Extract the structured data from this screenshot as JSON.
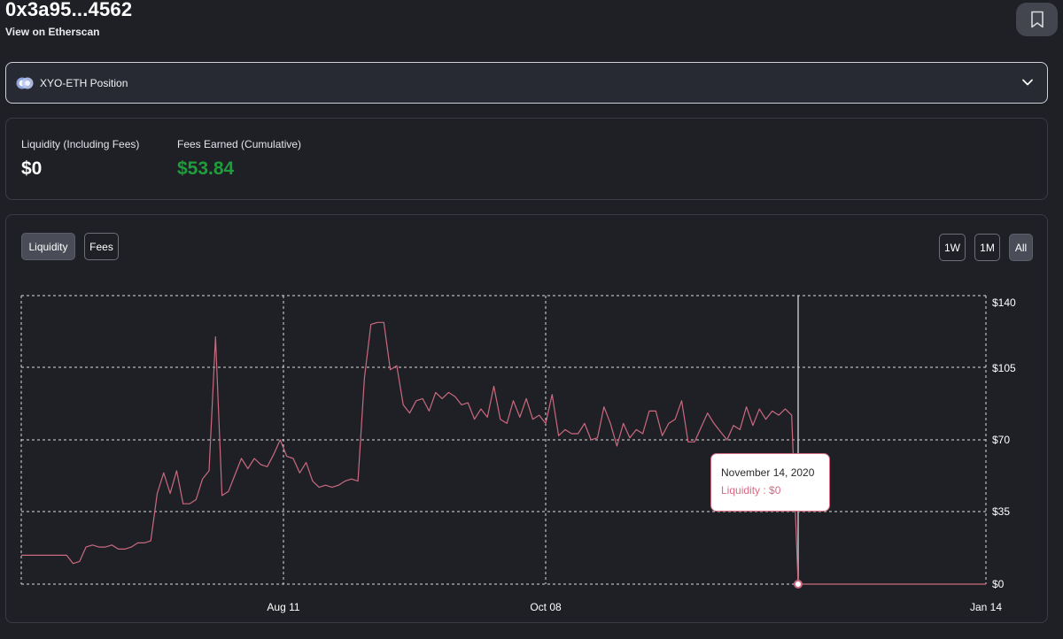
{
  "header": {
    "address": "0x3a95...4562",
    "etherscan_link": "View on Etherscan"
  },
  "icons": {
    "bookmark": "bookmark-icon",
    "token_pair": "token-pair-icon",
    "dropdown": "chevron-down-icon"
  },
  "position_select": {
    "selected": "XYO-ETH Position"
  },
  "stats": {
    "liquidity_label": "Liquidity (Including Fees)",
    "liquidity_value": "$0",
    "fees_label": "Fees Earned (Cumulative)",
    "fees_value": "$53.84"
  },
  "chart_controls": {
    "tabs": [
      {
        "label": "Liquidity",
        "active": true
      },
      {
        "label": "Fees",
        "active": false
      }
    ],
    "ranges": [
      {
        "label": "1W",
        "active": false
      },
      {
        "label": "1M",
        "active": false
      },
      {
        "label": "All",
        "active": true
      }
    ]
  },
  "tooltip": {
    "date": "November 14, 2020",
    "value_text": "Liquidity : $0"
  },
  "colors": {
    "line": "#c96a7e",
    "fees_green": "#1e9e3a",
    "background": "#1f2026"
  },
  "chart_data": {
    "type": "line",
    "series": [
      {
        "values": [
          14,
          14,
          14,
          14,
          14,
          14,
          14,
          14,
          10,
          11,
          18,
          19,
          18,
          18,
          19,
          17,
          17,
          18,
          20,
          20,
          21,
          44,
          54,
          44,
          55,
          39,
          39,
          41,
          51,
          55,
          120,
          43,
          45,
          53,
          61,
          56,
          61,
          58,
          57,
          63,
          70,
          62,
          61,
          54,
          59,
          50,
          47,
          48,
          47,
          48,
          50,
          51,
          50,
          100,
          126,
          127,
          127,
          104,
          106,
          87,
          83,
          89,
          90,
          84,
          93,
          90,
          93,
          91,
          87,
          88,
          80,
          85,
          81,
          96,
          80,
          78,
          89,
          81,
          90,
          80,
          82,
          78,
          92,
          72,
          75,
          73,
          73,
          78,
          70,
          71,
          86,
          78,
          67,
          78,
          71,
          75,
          73,
          84,
          84,
          72,
          78,
          80,
          89,
          69,
          69,
          76,
          83,
          78,
          74,
          70,
          77,
          75,
          86,
          77,
          85,
          80,
          84,
          82,
          85,
          82,
          0,
          0,
          0,
          0,
          0,
          0,
          0,
          0,
          0,
          0,
          0,
          0,
          0,
          0,
          0,
          0,
          0,
          0,
          0,
          0,
          0,
          0,
          0,
          0,
          0,
          0,
          0,
          0,
          0,
          0
        ]
      }
    ],
    "x_tick_labels": [
      "Aug 11",
      "Oct 08",
      "Jan 14"
    ],
    "y_tick_labels": [
      "$0",
      "$35",
      "$70",
      "$105",
      "$140"
    ],
    "ylim": [
      0,
      140
    ],
    "y_ticks": [
      0,
      35,
      70,
      105,
      140
    ],
    "grid": true,
    "hover_index": 120
  }
}
